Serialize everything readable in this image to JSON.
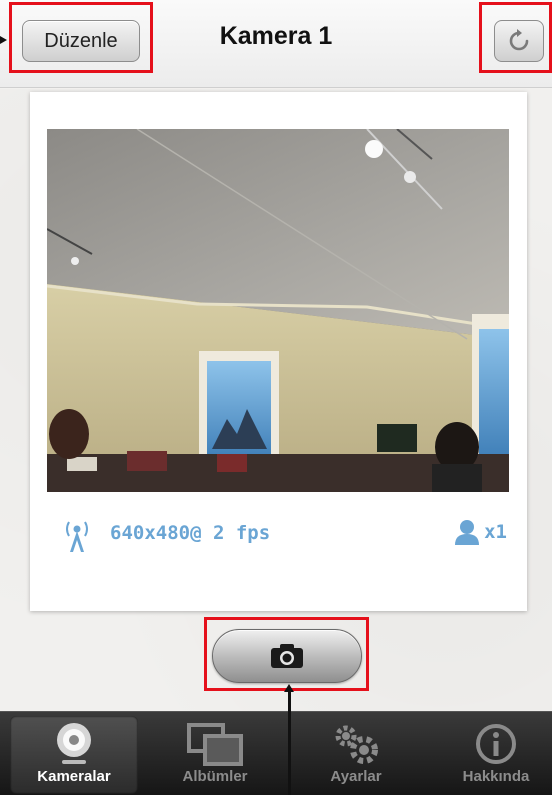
{
  "navbar": {
    "title": "Kamera 1",
    "edit_label": "Düzenle",
    "refresh_icon": "refresh-icon"
  },
  "camera": {
    "resolution": "640x480@ 2 fps",
    "viewers": "x1",
    "stream_icon": "antenna-icon",
    "viewer_icon": "person-icon",
    "accent_color": "#6aa5d4"
  },
  "snapshot": {
    "icon": "camera-icon"
  },
  "tabs": [
    {
      "label": "Kameralar",
      "icon": "webcam-icon",
      "active": true
    },
    {
      "label": "Albümler",
      "icon": "photos-icon",
      "active": false
    },
    {
      "label": "Ayarlar",
      "icon": "gears-icon",
      "active": false
    },
    {
      "label": "Hakkında",
      "icon": "info-icon",
      "active": false
    }
  ],
  "annotation_color": "#e5101b"
}
